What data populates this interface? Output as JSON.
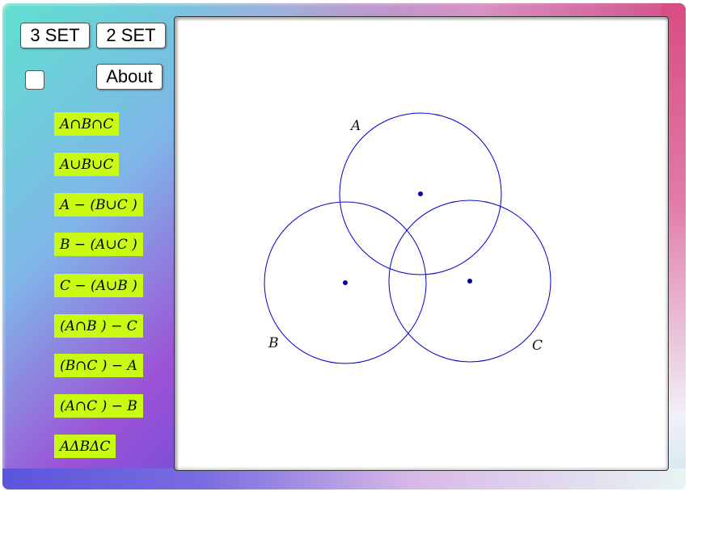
{
  "buttons": {
    "three_set": "3 SET",
    "two_set": "2 SET",
    "about": "About"
  },
  "checkbox": {
    "checked": false
  },
  "set_operations": [
    "A∩B∩C",
    "A∪B∪C",
    "A − (B∪C )",
    "B − (A∪C )",
    "C − (A∪B )",
    "(A∩B ) − C",
    "(B∩C ) − A",
    "(A∩C ) − B",
    "AΔBΔC"
  ],
  "circles": [
    {
      "label": "A",
      "color": "#0000cc"
    },
    {
      "label": "B",
      "color": "#0000cc"
    },
    {
      "label": "C",
      "color": "#0000cc"
    }
  ],
  "colors": {
    "operation_bg": "#c8fa14",
    "circle_stroke": "#0000cc",
    "center_dot": "#0000aa"
  }
}
